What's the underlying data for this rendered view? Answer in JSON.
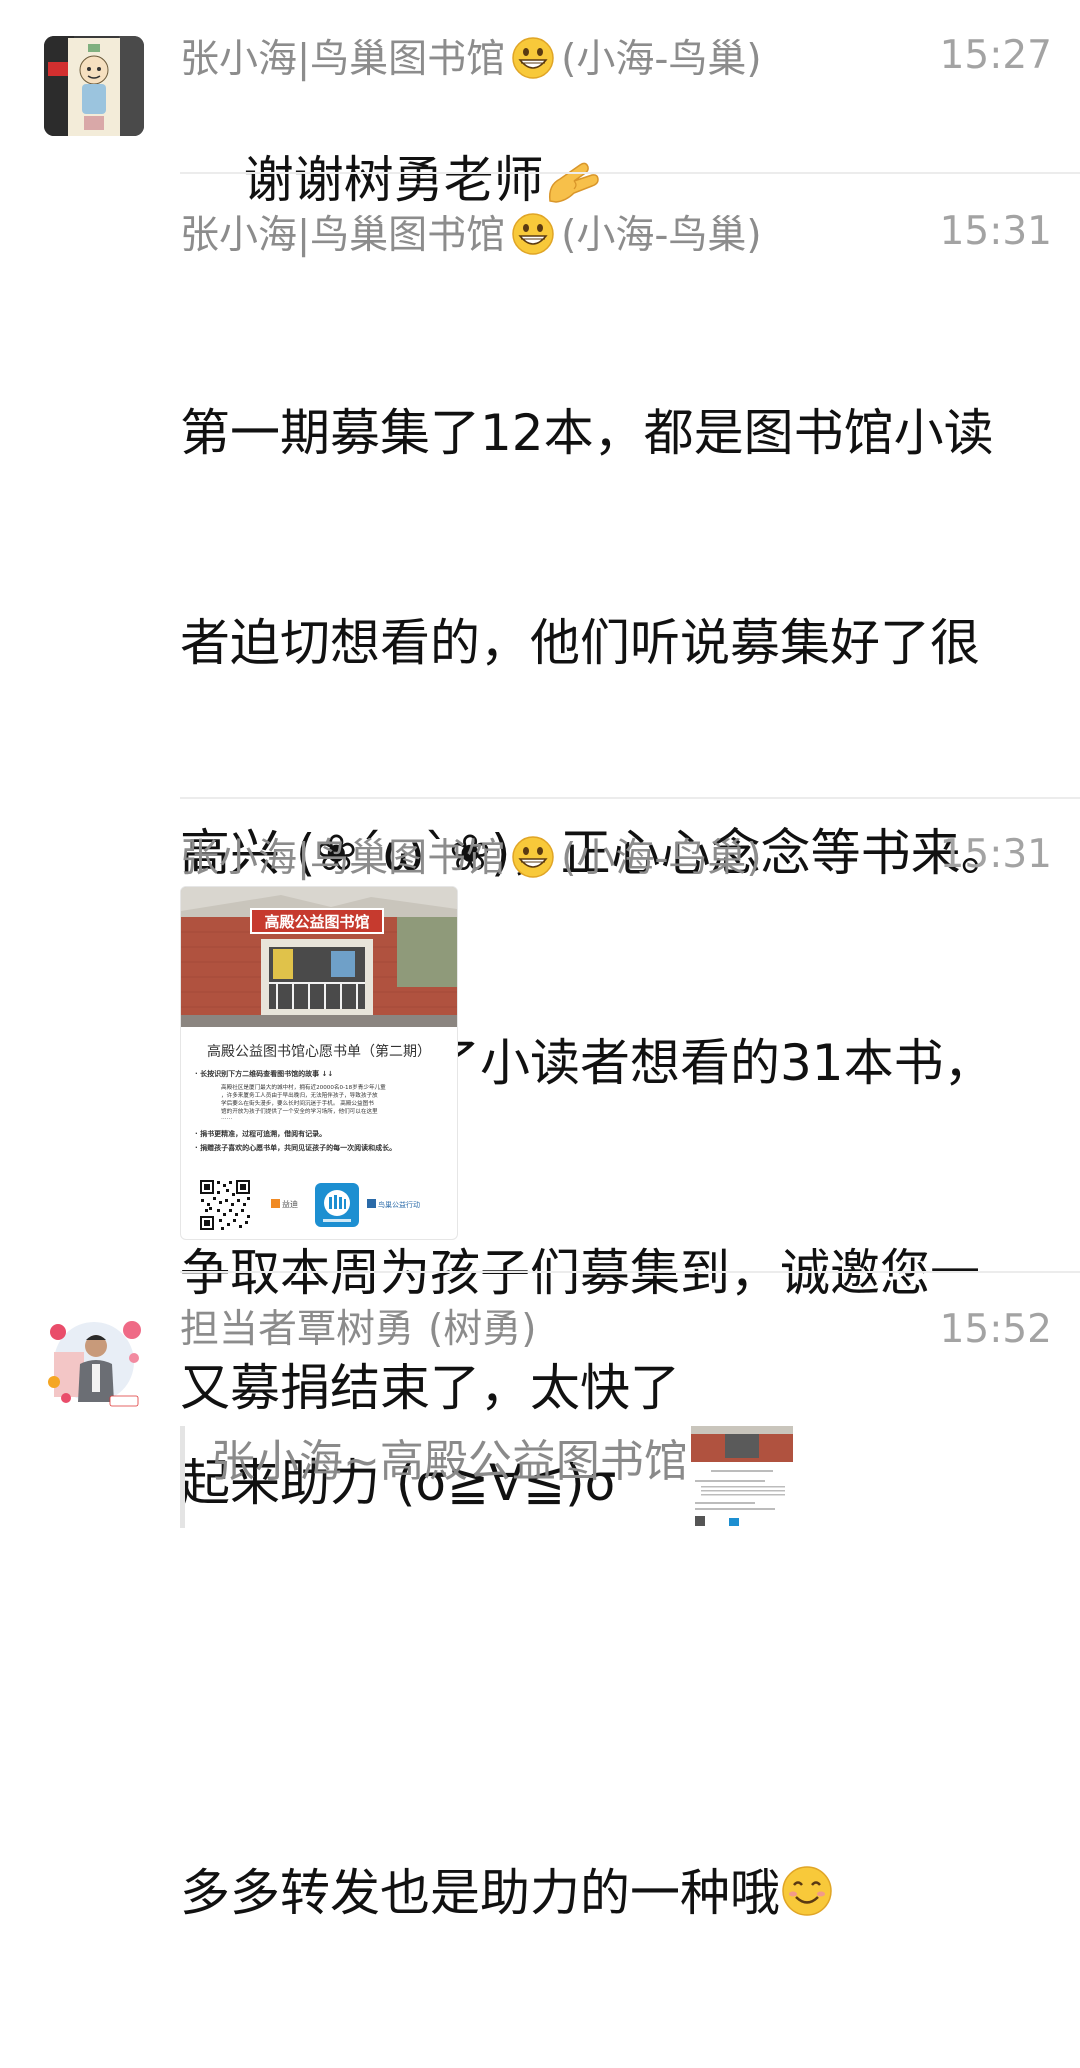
{
  "messages": [
    {
      "sender_name": "张小海|鸟巢图书馆",
      "sender_alias": "(小海-鸟巢)",
      "time": "15:27",
      "text": "谢谢树勇老师"
    },
    {
      "sender_name": "张小海|鸟巢图书馆",
      "sender_alias": "(小海-鸟巢)",
      "time": "15:31",
      "text_lines": [
        "第一期募集了12本，都是图书馆小读",
        "者迫切想看的，他们听说募集好了很",
        "高兴 (❀´ω`❀)，正心心念念等书来。",
        "现在又收集了小读者想看的31本书，",
        "争取本周为孩子们募集到，诚邀您一",
        "起来助力 (σ≧∀≦)σ"
      ],
      "text_tail": "多多转发也是助力的一种哦"
    },
    {
      "sender_name": "张小海|鸟巢图书馆",
      "sender_alias": "(小海-鸟巢)",
      "time": "15:31",
      "image": {
        "sign_text": "高殿公益图书馆",
        "title": "高殿公益图书馆心愿书单（第二期）",
        "line1": "· 长按识别下方二维码查看图书馆的故事 ↓↓",
        "body_lines": [
          "高殿社区是厦门最大的城中村，拥有近20000名0-18岁青少年儿童",
          "，许多来厦务工人员由于早出晚归，无法陪伴孩子，导致孩子放",
          "学后要么在街头漫步，要么长时间沉迷于手机。 高殿公益图书",
          "馆的开放为孩子们提供了一个安全的学习场所，他们可以在这里",
          "……"
        ],
        "line2": "· 捐书更精准，过程可追溯，借阅有记录。",
        "line3": "· 捐赠孩子喜欢的心愿书单，共同见证孩子的每一次阅读和成长。",
        "logo1": "益迪",
        "logo3": "鸟巢公益行动"
      }
    },
    {
      "sender_name": "担当者覃树勇",
      "sender_alias": "(树勇)",
      "time": "15:52",
      "text": "又募捐结束了，太快了",
      "quote_text": "张小海~高殿公益图书馆:"
    }
  ],
  "colors": {
    "sender": "#8c8c8c",
    "time": "#a3a3a3",
    "text": "#111111",
    "divider": "#ececec",
    "quote_bar": "#e4e4e4"
  },
  "icons": [
    "grinning-face-emoji",
    "pinching-hand-emoji",
    "smiling-face-emoji"
  ]
}
